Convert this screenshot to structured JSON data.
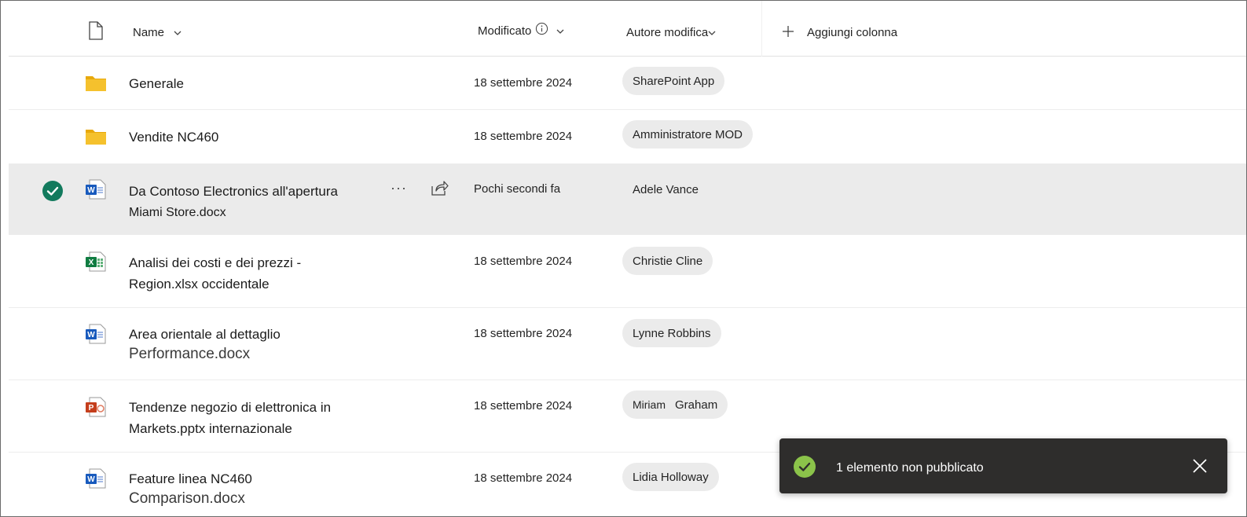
{
  "header": {
    "name_label": "Name",
    "modified_label": "Modificato",
    "author_label": "Autore modifica",
    "add_column_label": "Aggiungi colonna"
  },
  "rows": [
    {
      "type": "folder",
      "name_line1": "Generale",
      "name_line2": "",
      "modified": "18 settembre 2024",
      "author": "SharePoint App"
    },
    {
      "type": "folder",
      "name_line1": "Vendite NC460",
      "name_line2": "",
      "modified": "18 settembre 2024",
      "author": "Amministratore MOD"
    },
    {
      "type": "word",
      "name_line1": "Da Contoso Electronics all'apertura",
      "name_line2": "Miami Store.docx",
      "modified": "Pochi secondi fa",
      "author": "Adele Vance",
      "selected": true
    },
    {
      "type": "excel",
      "name_line1": "Analisi dei costi e dei prezzi -",
      "name_line2": "Region.xlsx occidentale",
      "modified": "18 settembre 2024",
      "author": "Christie Cline"
    },
    {
      "type": "word",
      "name_line1": "Area orientale al dettaglio",
      "name_line2": "Performance.docx",
      "modified": "18 settembre 2024",
      "author": "Lynne Robbins"
    },
    {
      "type": "powerpoint",
      "name_line1": "Tendenze negozio di elettronica in",
      "name_line2": "Markets.pptx internazionale",
      "modified": "18 settembre 2024",
      "author_first": "Miriam",
      "author_last": "Graham"
    },
    {
      "type": "word",
      "name_line1": "Feature linea NC460",
      "name_line2": "Comparison.docx",
      "modified": "18 settembre 2024",
      "author": "Lidia Holloway"
    }
  ],
  "row_actions": {
    "more_label": "···"
  },
  "toast": {
    "message": "1 elemento non pubblicato"
  },
  "colors": {
    "selected_row": "#ebebeb",
    "check_green": "#127a5d",
    "toast_bg": "#2e2d2c",
    "toast_ok": "#8bc34a",
    "folder": "#f5c12d",
    "word": "#185abd",
    "excel": "#107c41",
    "powerpoint": "#c43e1c"
  }
}
